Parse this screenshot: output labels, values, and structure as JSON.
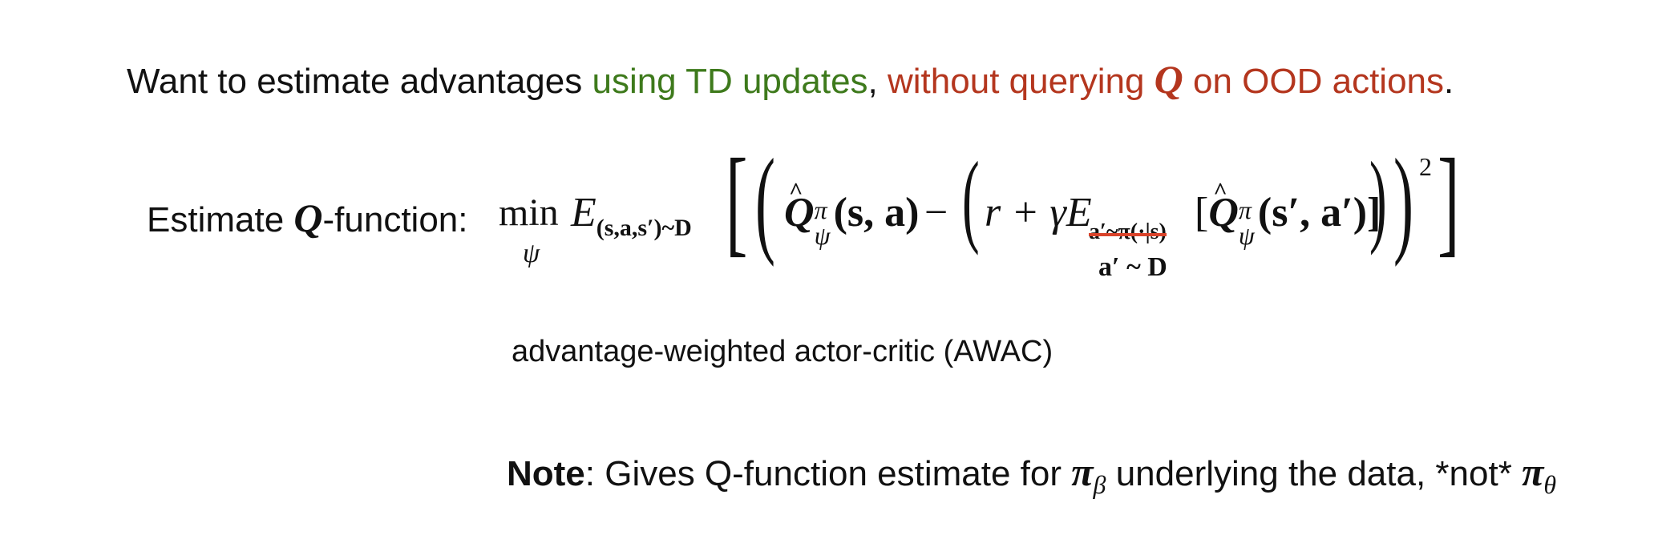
{
  "heading": {
    "part1": "Want to estimate advantages ",
    "part2_green": "using TD updates",
    "part3": ", ",
    "part4_red": "without querying ",
    "part5_red_symbol": "Q",
    "part6_red": " on OOD actions",
    "part7": "."
  },
  "equation": {
    "label_pre": "Estimate ",
    "label_symbol": "Q",
    "label_post": "-function:",
    "min": "min",
    "min_sub": "ψ",
    "expect": "E",
    "expect_sub": "(s,a,s′)~D",
    "q_hat": "Q",
    "q_sup": "π",
    "q_sub": "ψ",
    "args1": "(s, a)",
    "minus": "−",
    "r_gamma": "r + γE",
    "struck_sub": "a′~π(·|s)",
    "inner_args": "(s′, a′)]",
    "replacement_sub": "a′ ~ D",
    "exponent": "2"
  },
  "caption": "advantage-weighted actor-critic (AWAC)",
  "note": {
    "bold": "Note",
    "text1": ": Gives Q-function estimate for ",
    "pi_beta": "π",
    "pi_beta_sub": "β",
    "text2": " underlying the data, *not* ",
    "pi_theta": "π",
    "pi_theta_sub": "θ"
  }
}
